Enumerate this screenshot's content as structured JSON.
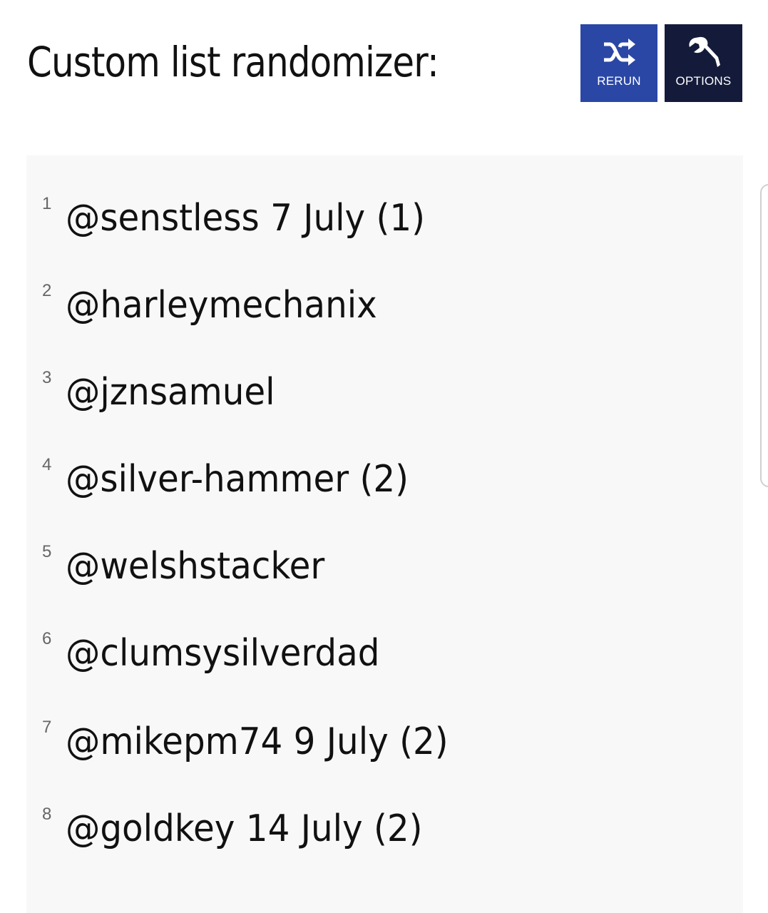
{
  "header": {
    "title": "Custom list randomizer:"
  },
  "toolbar": {
    "rerun_label": "RERUN",
    "rerun_icon": "shuffle-icon",
    "options_label": "OPTIONS",
    "options_icon": "wrench-icon"
  },
  "colors": {
    "rerun_bg": "#2a47a6",
    "options_bg": "#141b3a",
    "panel_bg": "#f8f8f8"
  },
  "list": {
    "items": [
      {
        "num": "1",
        "text": "@senstless 7 July (1)"
      },
      {
        "num": "2",
        "text": "@harleymechanix"
      },
      {
        "num": "3",
        "text": "@jznsamuel"
      },
      {
        "num": "4",
        "text": "@silver-hammer (2)"
      },
      {
        "num": "5",
        "text": "@welshstacker"
      },
      {
        "num": "6",
        "text": "@clumsysilverdad"
      },
      {
        "num": "7",
        "text": "@mikepm74 9 July (2)"
      },
      {
        "num": "8",
        "text": "@goldkey 14 July (2)"
      }
    ]
  }
}
